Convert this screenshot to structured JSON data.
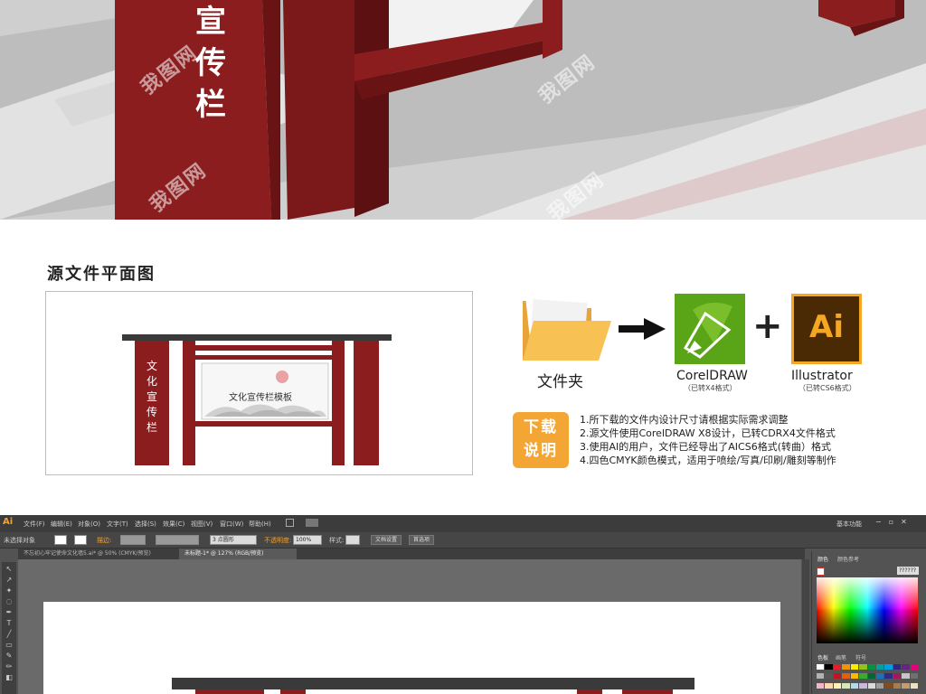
{
  "render": {
    "sign_vertical_text": [
      "宣",
      "传",
      "栏"
    ],
    "watermark": "我图网"
  },
  "section": {
    "title": "源文件平面图"
  },
  "plan": {
    "vertical_text": [
      "文",
      "化",
      "宣",
      "传",
      "栏"
    ],
    "panel_label": "文化宣传栏模板"
  },
  "flow": {
    "folder_label": "文件夹",
    "corel_label": "CorelDRAW",
    "corel_sub": "（已转X4格式）",
    "plus": "+",
    "ai_icon_text": "Ai",
    "ai_label": "Illustrator",
    "ai_sub": "（已转CS6格式）"
  },
  "download": {
    "badge_line1": "下载",
    "badge_line2": "说明",
    "notes": [
      "1.所下载的文件内设计尺寸请根据实际需求调整",
      "2.源文件使用CorelDRAW X8设计，已转CDRX4文件格式",
      "3.使用AI的用户，文件已经导出了AICS6格式(转曲）格式",
      "4.四色CMYK颜色模式，适用于喷绘/写真/印刷/雕刻等制作"
    ]
  },
  "app": {
    "logo": "Ai",
    "menus": [
      "文件(F)",
      "编辑(E)",
      "对象(O)",
      "文字(T)",
      "选择(S)",
      "效果(C)",
      "视图(V)",
      "窗口(W)",
      "帮助(H)"
    ],
    "workspace": "基本功能",
    "control": {
      "no_selection": "未选择对象",
      "stroke": "描边:",
      "stroke_size": "3 点圆形",
      "opacity_label": "不透明度:",
      "opacity_value": "100%",
      "style_label": "样式:",
      "doc_setup": "文档设置",
      "preferences": "首选项"
    },
    "tabs": [
      "不忘初心牢记使命文化墙5.ai* @ 50% (CMYK/预览)",
      "未标题-1* @ 127% (RGB/预览)"
    ],
    "panel": {
      "tab_color": "颜色",
      "tab_color_ref": "颜色参考",
      "hex_value": "??????",
      "tab_swatches": "色板",
      "tab_brush": "画笔",
      "tab_symbol": "符号"
    }
  }
}
